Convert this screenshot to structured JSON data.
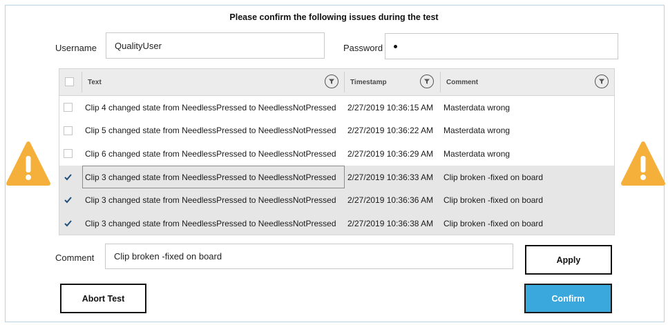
{
  "title": "Please confirm the following issues during the test",
  "username": {
    "label": "Username",
    "value": "QualityUser"
  },
  "password": {
    "label": "Password"
  },
  "grid": {
    "headers": {
      "text": "Text",
      "timestamp": "Timestamp",
      "comment": "Comment"
    },
    "rows": [
      {
        "checked": false,
        "selected": false,
        "text": "Clip 4 changed state from NeedlessPressed to NeedlessNotPressed",
        "timestamp": "2/27/2019 10:36:15 AM",
        "comment": "Masterdata wrong"
      },
      {
        "checked": false,
        "selected": false,
        "text": "Clip 5 changed state from NeedlessPressed to NeedlessNotPressed",
        "timestamp": "2/27/2019 10:36:22 AM",
        "comment": "Masterdata wrong"
      },
      {
        "checked": false,
        "selected": false,
        "text": "Clip 6 changed state from NeedlessPressed to NeedlessNotPressed",
        "timestamp": "2/27/2019 10:36:29 AM",
        "comment": "Masterdata wrong"
      },
      {
        "checked": true,
        "selected": true,
        "text": "Clip 3 changed state from NeedlessPressed to NeedlessNotPressed",
        "timestamp": "2/27/2019 10:36:33 AM",
        "comment": "Clip broken -fixed on board"
      },
      {
        "checked": true,
        "selected": true,
        "text": "Clip 3 changed state from NeedlessPressed to NeedlessNotPressed",
        "timestamp": "2/27/2019 10:36:36 AM",
        "comment": "Clip broken -fixed on board"
      },
      {
        "checked": true,
        "selected": true,
        "text": "Clip 3 changed state from NeedlessPressed to NeedlessNotPressed",
        "timestamp": "2/27/2019 10:36:38 AM",
        "comment": "Clip broken -fixed on board"
      }
    ]
  },
  "comment": {
    "label": "Comment",
    "value": "Clip broken -fixed on board"
  },
  "buttons": {
    "apply": "Apply",
    "abort": "Abort Test",
    "confirm": "Confirm"
  },
  "icons": {
    "warning": "warning-triangle-icon",
    "filter": "filter-icon",
    "checkbox": "checkbox-icon"
  },
  "colors": {
    "warning": "#f4b03a",
    "confirm": "#3aa7dd",
    "selected_row": "#e6e6e6",
    "header": "#ececec"
  }
}
